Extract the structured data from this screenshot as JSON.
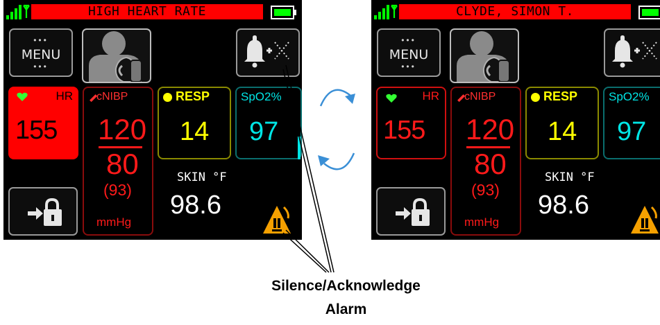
{
  "monitors": [
    {
      "banner": "HIGH HEART RATE",
      "menu_label": "MENU",
      "hr": {
        "label": "HR",
        "value": "155"
      },
      "nibp": {
        "label": "cNIBP",
        "systolic": "120",
        "diastolic": "80",
        "mean": "(93)",
        "unit": "mmHg"
      },
      "resp": {
        "label": "RESP",
        "value": "14"
      },
      "spo2": {
        "label": "SpO2%",
        "value": "97"
      },
      "skin": {
        "label": "SKIN °F",
        "value": "98.6"
      }
    },
    {
      "banner": "CLYDE, SIMON T.",
      "menu_label": "MENU",
      "hr": {
        "label": "HR",
        "value": "155"
      },
      "nibp": {
        "label": "cNIBP",
        "systolic": "120",
        "diastolic": "80",
        "mean": "(93)",
        "unit": "mmHg"
      },
      "resp": {
        "label": "RESP",
        "value": "14"
      },
      "spo2": {
        "label": "SpO2%",
        "value": "97"
      },
      "skin": {
        "label": "SKIN °F",
        "value": "98.6"
      }
    }
  ],
  "annotation": {
    "line1": "Silence/Acknowledge",
    "line2": "Alarm"
  },
  "colors": {
    "banner": "#ff0000",
    "hr": "#ff0000",
    "nibp": "#ff1a1a",
    "resp": "#ffff00",
    "spo2": "#00e5e5",
    "battery": "#00ff00",
    "signal": "#00ff00",
    "warning": "#f5a000",
    "cycle_arrows": "#3a8fd6"
  },
  "icons": [
    "signal-icon",
    "battery-icon",
    "patient-icon",
    "bell-icon",
    "heart-icon",
    "lock-icon",
    "alarm-warning-icon",
    "cycle-arrow-icon"
  ]
}
